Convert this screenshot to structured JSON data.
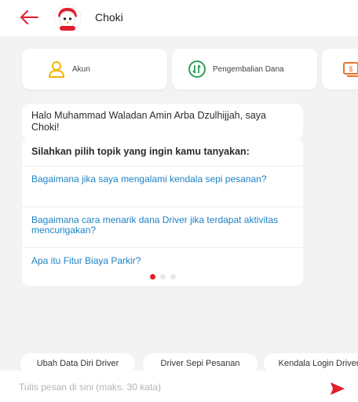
{
  "header": {
    "title": "Choki"
  },
  "shortcuts": [
    {
      "label": "Akun",
      "icon": "user-icon"
    },
    {
      "label": "Pengembalian Dana",
      "icon": "refund-icon"
    },
    {
      "label": "",
      "icon": "payment-icon"
    }
  ],
  "greeting": "Halo Muhammad Waladan Amin Arba Dzulhijjah, saya Choki!",
  "topics": {
    "heading": "Silahkan pilih topik yang ingin kamu tanyakan:",
    "items": [
      "Bagaimana jika saya mengalami kendala sepi pesanan?",
      "Bagaimana cara menarik dana Driver jika terdapat aktivitas mencurigakan?",
      "Apa itu Fitur Biaya Parkir?"
    ],
    "page_count": 3,
    "active_page": 1
  },
  "quick_replies": [
    "Ubah Data Diri Driver",
    "Driver Sepi Pesanan",
    "Kendala Login Driver"
  ],
  "composer": {
    "placeholder": "Tulis pesan di sini (maks. 30 kata)"
  },
  "colors": {
    "accent": "#e31e2d",
    "link": "#1e82c4",
    "icon_yellow": "#f2b705",
    "icon_green": "#2e9e5b",
    "icon_orange": "#e9742b"
  }
}
